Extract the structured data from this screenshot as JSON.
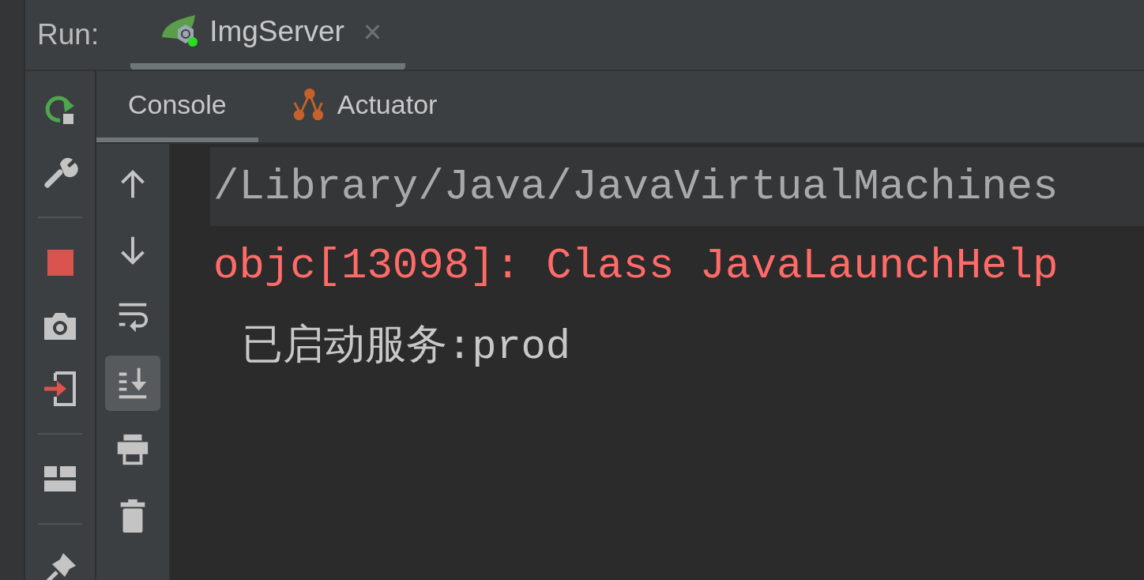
{
  "run_bar": {
    "label": "Run:",
    "tabs": [
      {
        "title": "ImgServer",
        "close": "×",
        "selected": true
      }
    ]
  },
  "left_toolbar": [
    {
      "kind": "rerun"
    },
    {
      "kind": "wrench"
    },
    {
      "kind": "divider"
    },
    {
      "kind": "stop"
    },
    {
      "kind": "camera"
    },
    {
      "kind": "enter"
    },
    {
      "kind": "divider"
    },
    {
      "kind": "layout"
    },
    {
      "kind": "divider"
    },
    {
      "kind": "pin"
    }
  ],
  "tabs": [
    {
      "label": "Console",
      "kind": "console",
      "selected": true
    },
    {
      "label": "Actuator",
      "kind": "actuator",
      "selected": false
    }
  ],
  "console_toolbar": [
    {
      "kind": "up",
      "on": false
    },
    {
      "kind": "down",
      "on": false
    },
    {
      "kind": "wrap",
      "on": false
    },
    {
      "kind": "scroll-end",
      "on": true
    },
    {
      "kind": "print",
      "on": false
    },
    {
      "kind": "trash",
      "on": false
    }
  ],
  "console_lines": [
    {
      "kind": "command",
      "text": "/Library/Java/JavaVirtualMachines"
    },
    {
      "kind": "error",
      "text": "objc[13098]: Class JavaLaunchHelp"
    },
    {
      "kind": "output",
      "text": "已启动服务:prod"
    }
  ]
}
